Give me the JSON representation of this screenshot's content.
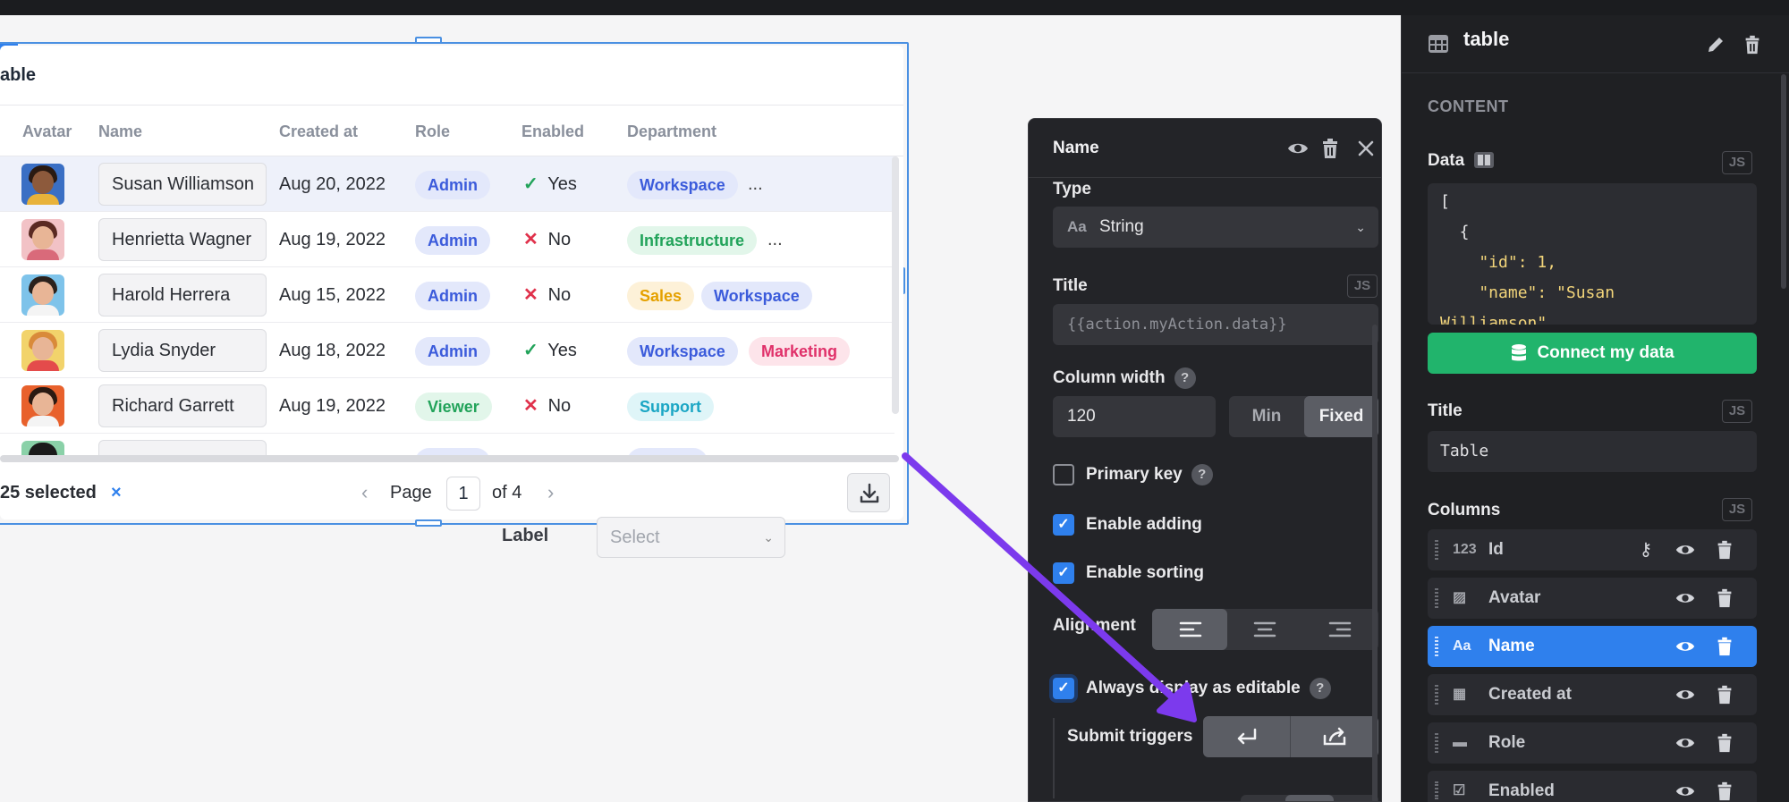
{
  "table": {
    "tag": "e",
    "title": "able",
    "headers": [
      "Avatar",
      "Name",
      "Created at",
      "Role",
      "Enabled",
      "Department"
    ],
    "rows": [
      {
        "name": "Susan Williamson",
        "created": "Aug 20, 2022",
        "role": "Admin",
        "enabled_mark": "✓",
        "enabled": "Yes",
        "departments": [
          "Workspace"
        ],
        "more": "..."
      },
      {
        "name": "Henrietta Wagner",
        "created": "Aug 19, 2022",
        "role": "Admin",
        "enabled_mark": "✕",
        "enabled": "No",
        "departments": [
          "Infrastructure"
        ],
        "more": "..."
      },
      {
        "name": "Harold Herrera",
        "created": "Aug 15, 2022",
        "role": "Admin",
        "enabled_mark": "✕",
        "enabled": "No",
        "departments": [
          "Sales",
          "Workspace"
        ],
        "more": ""
      },
      {
        "name": "Lydia Snyder",
        "created": "Aug 18, 2022",
        "role": "Admin",
        "enabled_mark": "✓",
        "enabled": "Yes",
        "departments": [
          "Workspace",
          "Marketing"
        ],
        "more": ""
      },
      {
        "name": "Richard Garrett",
        "created": "Aug 19, 2022",
        "role": "Viewer",
        "enabled_mark": "✕",
        "enabled": "No",
        "departments": [
          "Support"
        ],
        "more": ""
      }
    ],
    "selected_text": "25 selected",
    "clear_selection": "×",
    "page_label": "Page",
    "page_current": "1",
    "page_of": "of 4",
    "prev": "‹",
    "next": "›"
  },
  "canvas_form": {
    "label": "Label",
    "select_placeholder": "Select",
    "select_chevron": "⌄"
  },
  "column_editor": {
    "title": "Name",
    "type_label": "Type",
    "type_icon": "Aa",
    "type_value": "String",
    "title_label": "Title",
    "js": "JS",
    "title_placeholder": "{{action.myAction.data}}",
    "width_label": "Column width",
    "help": "?",
    "width_value": "120",
    "width_min": "Min",
    "width_fixed": "Fixed",
    "primary_key": "Primary key",
    "enable_adding": "Enable adding",
    "enable_sorting": "Enable sorting",
    "alignment_label": "Alignment",
    "always_editable": "Always display as editable",
    "submit_triggers": "Submit triggers"
  },
  "properties_panel": {
    "title": "table",
    "content_section": "CONTENT",
    "data_label": "Data",
    "js": "JS",
    "code_lines": [
      "[",
      "  {",
      "    \"id\": 1,",
      "    \"name\": \"Susan",
      "Williamson\","
    ],
    "connect_label": "Connect my data",
    "title_label": "Title",
    "title_value": "Table",
    "columns_label": "Columns",
    "columns": [
      {
        "icon": "123",
        "name": "Id"
      },
      {
        "icon": "▨",
        "name": "Avatar"
      },
      {
        "icon": "Aa",
        "name": "Name"
      },
      {
        "icon": "▦",
        "name": "Created at"
      },
      {
        "icon": "▬",
        "name": "Role"
      },
      {
        "icon": "☑",
        "name": "Enabled"
      }
    ]
  },
  "colors": {
    "accent_blue": "#2f80ed",
    "connect_green": "#21b46c",
    "arrow_purple": "#7c3aed",
    "panel_dark": "#232428"
  }
}
